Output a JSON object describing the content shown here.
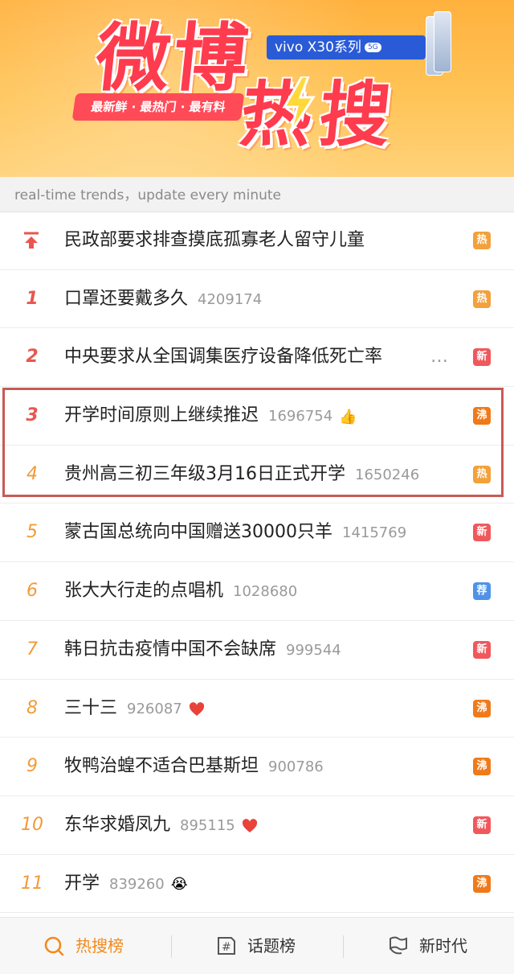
{
  "banner": {
    "title_top": "微博",
    "title_bottom": "热搜",
    "slogan": "最新鲜 · 最热门 · 最有料",
    "ad_label": "vivo X30系列",
    "ad_badge": "5G"
  },
  "subtitle": "real-time trends，update every minute",
  "colors": {
    "hot": "#f2a13b",
    "new": "#f0585c",
    "boil": "#f07a1a",
    "recommend": "#4e93e8",
    "accent": "#f28a1b"
  },
  "items": [
    {
      "rank": "",
      "pinned": true,
      "title": "民政部要求排查摸底孤寡老人留守儿童",
      "count": "",
      "tag": "热",
      "tag_type": "hot"
    },
    {
      "rank": "1",
      "title": "口罩还要戴多久",
      "count": "4209174",
      "tag": "热",
      "tag_type": "hot"
    },
    {
      "rank": "2",
      "title": "中央要求从全国调集医疗设备降低死亡率",
      "count": "",
      "more": "…",
      "tag": "新",
      "tag_type": "new"
    },
    {
      "rank": "3",
      "title": "开学时间原则上继续推迟",
      "count": "1696754",
      "emoji": "👍",
      "tag": "沸",
      "tag_type": "boil"
    },
    {
      "rank": "4",
      "title": "贵州高三初三年级3月16日正式开学",
      "count": "1650246",
      "tag": "热",
      "tag_type": "hot"
    },
    {
      "rank": "5",
      "title": "蒙古国总统向中国赠送30000只羊",
      "count": "1415769",
      "tag": "新",
      "tag_type": "new"
    },
    {
      "rank": "6",
      "title": "张大大行走的点唱机",
      "count": "1028680",
      "tag": "荐",
      "tag_type": "recommend"
    },
    {
      "rank": "7",
      "title": "韩日抗击疫情中国不会缺席",
      "count": "999544",
      "tag": "新",
      "tag_type": "new"
    },
    {
      "rank": "8",
      "title": "三十三",
      "count": "926087",
      "heart": true,
      "tag": "沸",
      "tag_type": "boil"
    },
    {
      "rank": "9",
      "title": "牧鸭治蝗不适合巴基斯坦",
      "count": "900786",
      "tag": "沸",
      "tag_type": "boil"
    },
    {
      "rank": "10",
      "title": "东华求婚凤九",
      "count": "895115",
      "heart": true,
      "tag": "新",
      "tag_type": "new"
    },
    {
      "rank": "11",
      "title": "开学",
      "count": "839260",
      "emoji": "😭",
      "tag": "沸",
      "tag_type": "boil"
    }
  ],
  "tabs": [
    {
      "label": "热搜榜",
      "icon": "search-icon",
      "active": true
    },
    {
      "label": "话题榜",
      "icon": "hashtag-icon",
      "active": false
    },
    {
      "label": "新时代",
      "icon": "flag-icon",
      "active": false
    }
  ]
}
